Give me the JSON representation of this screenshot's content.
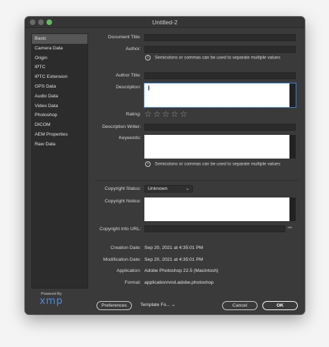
{
  "window": {
    "title": "Untitled-2"
  },
  "sidebar": {
    "items": [
      {
        "label": "Basic"
      },
      {
        "label": "Camera Data"
      },
      {
        "label": "Origin"
      },
      {
        "label": "IPTC"
      },
      {
        "label": "IPTC Extension"
      },
      {
        "label": "GPS Data"
      },
      {
        "label": "Audio Data"
      },
      {
        "label": "Video Data"
      },
      {
        "label": "Photoshop"
      },
      {
        "label": "DICOM"
      },
      {
        "label": "AEM Properties"
      },
      {
        "label": "Raw Data"
      }
    ],
    "active_index": 0
  },
  "branding": {
    "powered_by": "Powered By",
    "logo": "xmp"
  },
  "form": {
    "document_title_label": "Document Title:",
    "document_title_value": "",
    "author_label": "Author:",
    "author_value": "",
    "author_hint": "Semicolons or commas can be used to separate multiple values",
    "author_title_label": "Author Title:",
    "author_title_value": "",
    "description_label": "Description:",
    "description_value": "",
    "rating_label": "Rating:",
    "rating_value": 0,
    "rating_max": 5,
    "description_writer_label": "Description Writer:",
    "description_writer_value": "",
    "keywords_label": "Keywords:",
    "keywords_value": "",
    "keywords_hint": "Semicolons or commas can be used to separate multiple values",
    "copyright_status_label": "Copyright Status:",
    "copyright_status_value": "Unknown",
    "copyright_notice_label": "Copyright Notice:",
    "copyright_notice_value": "",
    "copyright_url_label": "Copyright Info URL:",
    "copyright_url_value": "",
    "creation_date_label": "Creation Date:",
    "creation_date_value": "Sep 20, 2021 at 4:35:01 PM",
    "modification_date_label": "Modification Date:",
    "modification_date_value": "Sep 20, 2021 at 4:35:01 PM",
    "application_label": "Application:",
    "application_value": "Adobe Photoshop 22.5 (Macintosh)",
    "format_label": "Format:",
    "format_value": "application/vnd.adobe.photoshop"
  },
  "footer": {
    "preferences_label": "Preferences",
    "template_label": "Template Fo...",
    "cancel_label": "Cancel",
    "ok_label": "OK"
  },
  "colors": {
    "focus": "#3b82d8",
    "accent_logo": "#4a8de0",
    "zoom_button": "#5fc05a"
  }
}
